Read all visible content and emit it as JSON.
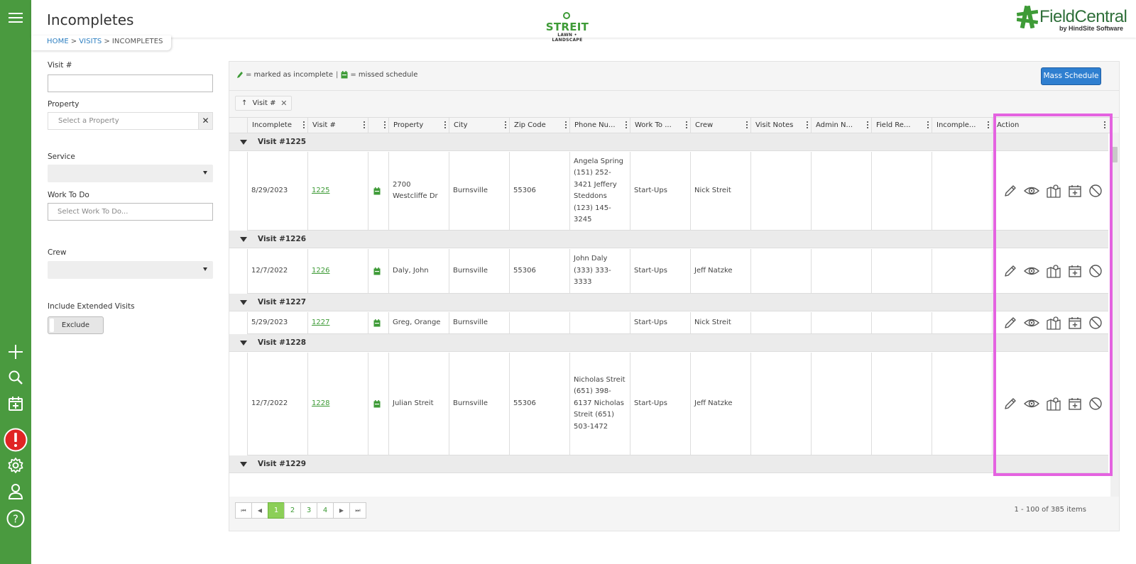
{
  "header": {
    "title": "Incompletes",
    "breadcrumb": [
      "HOME",
      "VISITS",
      "INCOMPLETES"
    ],
    "breadcrumb_sep": ">",
    "streit_name": "STREIT",
    "streit_sub": "LAWN • LANDSCAPE",
    "fc_name": "FieldCentral",
    "fc_sub": "by HindSite Software"
  },
  "rail": {
    "icons": [
      "menu-icon",
      "add-icon",
      "search-icon",
      "calendar-add-icon",
      "alert-icon",
      "gear-icon",
      "user-icon",
      "help-icon"
    ],
    "alert_color": "#e02424"
  },
  "filters": {
    "visit_label": "Visit #",
    "visit_value": "",
    "property_label": "Property",
    "property_placeholder": "Select a Property",
    "property_clear": "✕",
    "service_label": "Service",
    "work_label": "Work To Do",
    "work_placeholder": "Select Work To Do...",
    "crew_label": "Crew",
    "extended_label": "Include Extended Visits",
    "extended_value": "Exclude"
  },
  "grid": {
    "legend_incomplete": "= marked as incomplete",
    "legend_sep": "|",
    "legend_missed": "= missed schedule",
    "mass_schedule": "Mass Schedule",
    "group_chip": "Visit #",
    "group_chip_close": "✕",
    "columns": [
      "Incomplete",
      "Visit #",
      "",
      "Property",
      "City",
      "Zip Code",
      "Phone Nu...",
      "Work To ...",
      "Crew",
      "Visit Notes",
      "Admin N...",
      "Field Re...",
      "Incomple...",
      "Action"
    ],
    "groups": [
      {
        "label": "Visit #1225",
        "row": {
          "incomplete": "8/29/2023",
          "visit": "1225",
          "property": "2700 Westcliffe Dr",
          "city": "Burnsville",
          "zip": "55306",
          "phone": "Angela Spring (151) 252-3421 Jeffery Steddons (123) 145-3245",
          "work": "Start-Ups",
          "crew": "Nick Streit",
          "visit_notes": "",
          "admin_notes": "",
          "field_report": "",
          "incomplete_reason": ""
        }
      },
      {
        "label": "Visit #1226",
        "row": {
          "incomplete": "12/7/2022",
          "visit": "1226",
          "property": "Daly, John",
          "city": "Burnsville",
          "zip": "55306",
          "phone": "John Daly (333) 333-3333",
          "work": "Start-Ups",
          "crew": "Jeff Natzke",
          "visit_notes": "",
          "admin_notes": "",
          "field_report": "",
          "incomplete_reason": ""
        }
      },
      {
        "label": "Visit #1227",
        "row": {
          "incomplete": "5/29/2023",
          "visit": "1227",
          "property": "Greg, Orange",
          "city": "Burnsville",
          "zip": "",
          "phone": "",
          "work": "Start-Ups",
          "crew": "Nick Streit",
          "visit_notes": "",
          "admin_notes": "",
          "field_report": "",
          "incomplete_reason": ""
        }
      },
      {
        "label": "Visit #1228",
        "row": {
          "incomplete": "12/7/2022",
          "visit": "1228",
          "property": "Julian Streit",
          "city": "Burnsville",
          "zip": "55306",
          "phone": "Nicholas Streit (651) 398-6137 Nicholas Streit (651) 503-1472",
          "work": "Start-Ups",
          "crew": "Jeff Natzke",
          "visit_notes": "",
          "admin_notes": "",
          "field_report": "",
          "incomplete_reason": ""
        }
      },
      {
        "label": "Visit #1229",
        "row": null
      }
    ],
    "action_icons": [
      "pencil-icon",
      "eye-icon",
      "map-pin-icon",
      "calendar-add-icon",
      "cancel-icon"
    ],
    "status_icon": "calendar-missed-icon",
    "accent": "#3e9b37",
    "highlight_color": "#e463e0"
  },
  "pager": {
    "first": "⏮",
    "prev": "◀",
    "pages": [
      "1",
      "2",
      "3",
      "4"
    ],
    "current": "1",
    "next": "▶",
    "last": "⏭",
    "items_info": "1 - 100 of 385 items"
  }
}
